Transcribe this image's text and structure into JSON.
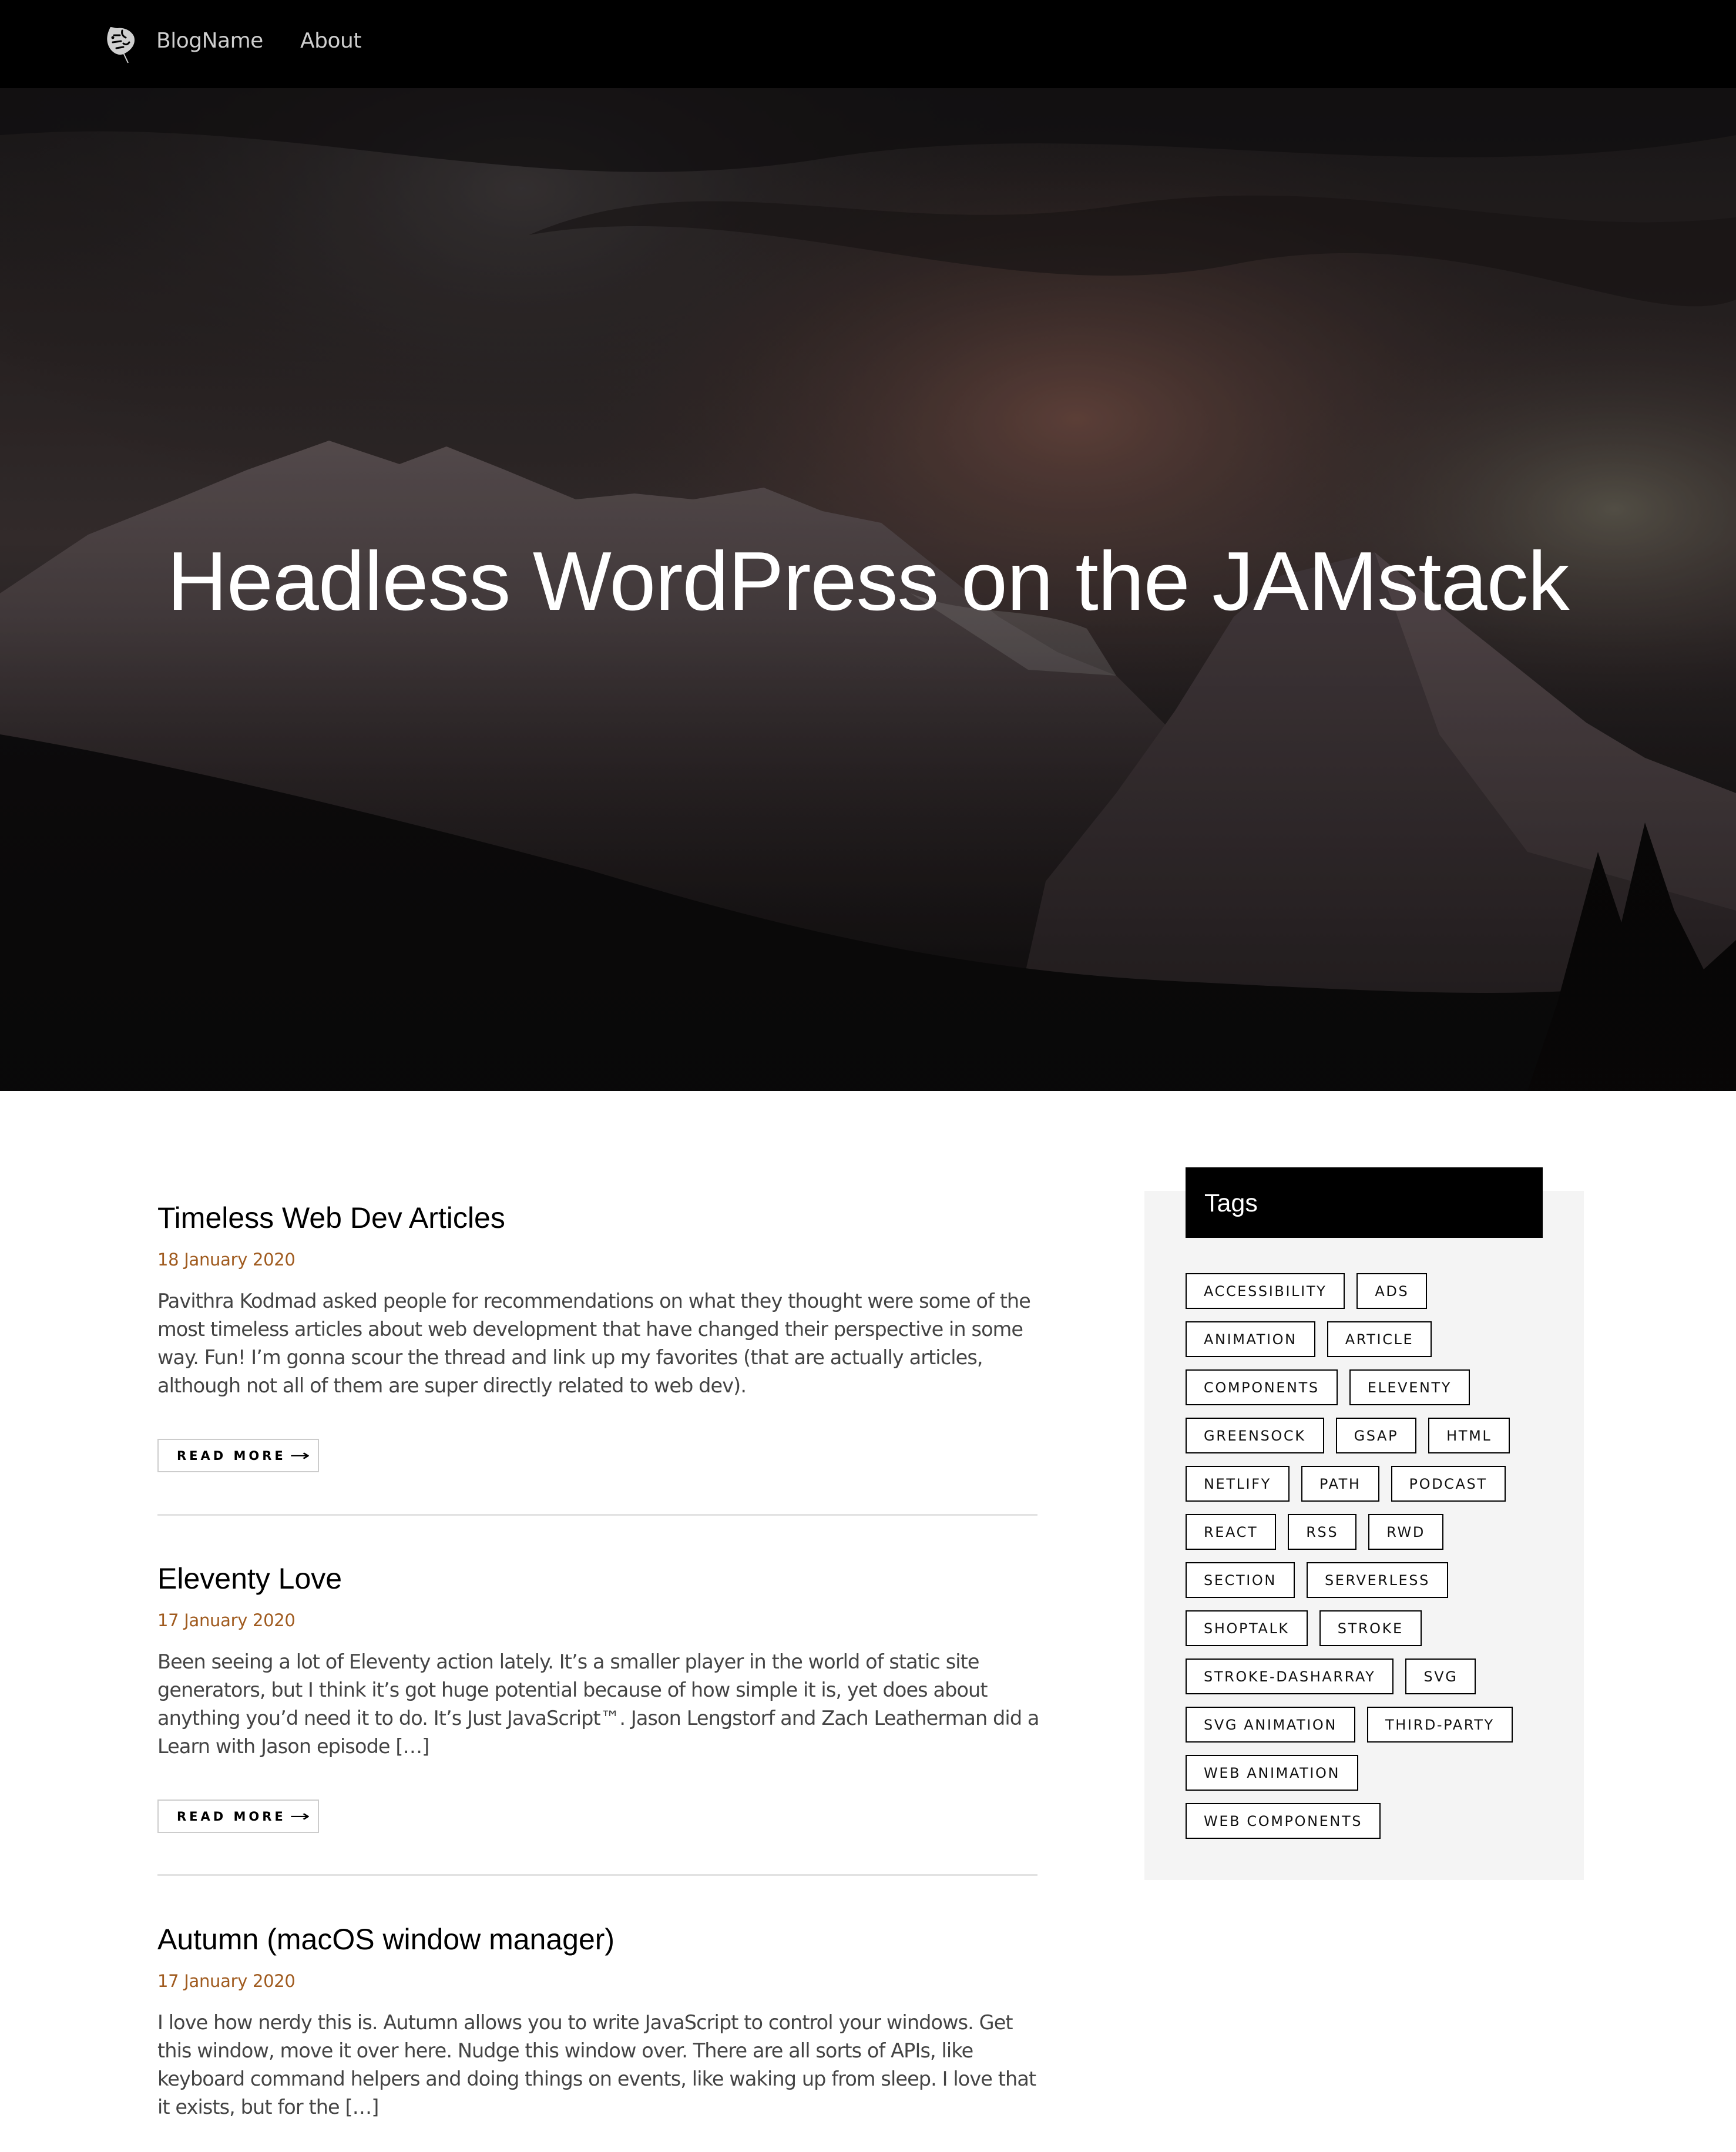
{
  "nav": {
    "logo_icon": "monstera-leaf-icon",
    "brand": "BlogName",
    "links": [
      {
        "label": "About"
      }
    ]
  },
  "hero": {
    "title": "Headless WordPress on the JAMstack",
    "background": "dark mountain landscape with cloudy sky"
  },
  "articles": [
    {
      "title": "Timeless Web Dev Articles",
      "date": "18 January 2020",
      "excerpt": "Pavithra Kodmad asked people for recommendations on what they thought were some of the most timeless articles about web development that have changed their perspective in some way. Fun! I’m gonna scour the thread and link up my favorites (that are actually articles, although not all of them are super directly related to web dev).",
      "read_more": "READ MORE",
      "read_more_icon": "long-arrow-right-icon"
    },
    {
      "title": "Eleventy Love",
      "date": "17 January 2020",
      "excerpt": "Been seeing a lot of Eleventy action lately. It’s a smaller player in the world of static site generators, but I think it’s got huge potential because of how simple it is, yet does about anything you’d need it to do. It’s Just JavaScript™. Jason Lengstorf and Zach Leatherman did a Learn with Jason episode […]",
      "read_more": "READ MORE",
      "read_more_icon": "long-arrow-right-icon"
    },
    {
      "title": "Autumn (macOS window manager)",
      "date": "17 January 2020",
      "excerpt": "I love how nerdy this is. Autumn allows you to write JavaScript to control your windows. Get this window, move it over here. Nudge this window over. There are all sorts of APIs, like keyboard command helpers and doing things on events, like waking up from sleep. I love that it exists, but for the […]"
    }
  ],
  "sidebar": {
    "title": "Tags",
    "tag_rows": [
      [
        "ACCESSIBILITY",
        "ADS"
      ],
      [
        "ANIMATION",
        "ARTICLE"
      ],
      [
        "COMPONENTS",
        "ELEVENTY"
      ],
      [
        "GREENSOCK",
        "GSAP",
        "HTML"
      ],
      [
        "NETLIFY",
        "PATH",
        "PODCAST"
      ],
      [
        "REACT",
        "RSS",
        "RWD"
      ],
      [
        "SECTION",
        "SERVERLESS"
      ],
      [
        "SHOPTALK",
        "STROKE"
      ],
      [
        "STROKE-DASHARRAY",
        "SVG"
      ],
      [
        "SVG ANIMATION",
        "THIRD-PARTY"
      ],
      [
        "WEB ANIMATION"
      ],
      [
        "WEB COMPONENTS"
      ]
    ]
  },
  "colors": {
    "nav_bg": "#000000",
    "nav_text": "#cfcfcf",
    "date": "#a05b1f",
    "excerpt": "#444444",
    "sidebar_bg": "#f4f4f4",
    "tags_header_bg": "#000000",
    "divider": "#e2e2e2",
    "button_border": "#cccccc"
  }
}
